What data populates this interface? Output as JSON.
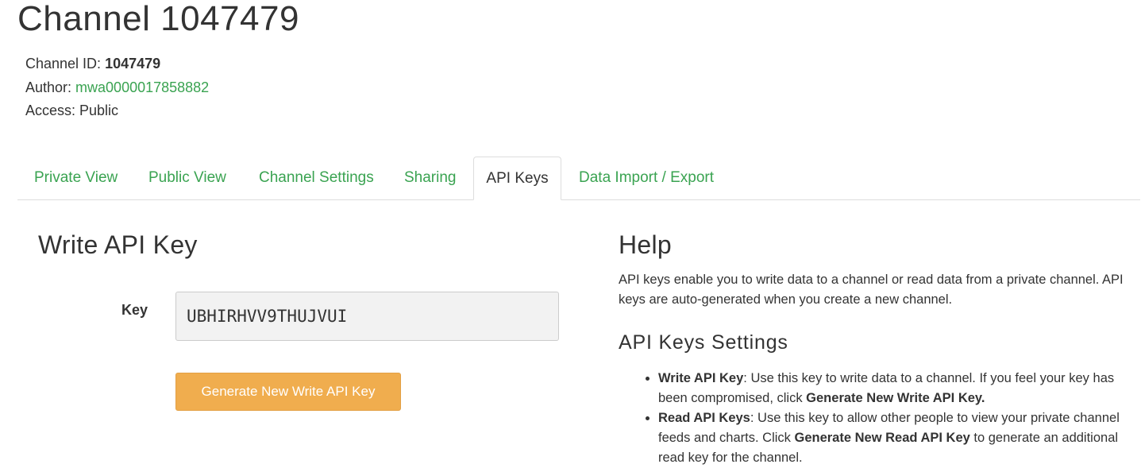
{
  "header": {
    "title": "Channel 1047479",
    "channel_id_label": "Channel ID: ",
    "channel_id_value": "1047479",
    "author_label": "Author: ",
    "author_value": "mwa0000017858882",
    "access_label": "Access: ",
    "access_value": "Public"
  },
  "tabs": [
    {
      "label": "Private View",
      "active": false
    },
    {
      "label": "Public View",
      "active": false
    },
    {
      "label": "Channel Settings",
      "active": false
    },
    {
      "label": "Sharing",
      "active": false
    },
    {
      "label": "API Keys",
      "active": true
    },
    {
      "label": "Data Import / Export",
      "active": false
    }
  ],
  "write_key": {
    "title": "Write API Key",
    "key_label": "Key",
    "key_value": "UBHIRHVV9THUJVUI",
    "generate_button_label": "Generate New Write API Key"
  },
  "help": {
    "title": "Help",
    "intro": "API keys enable you to write data to a channel or read data from a private channel. API keys are auto-generated when you create a new channel.",
    "settings_title": "API Keys Settings",
    "items": [
      {
        "term": "Write API Key",
        "text_before": ": Use this key to write data to a channel. If you feel your key has been compromised, click ",
        "emphasis": "Generate New Write API Key.",
        "text_after": ""
      },
      {
        "term": "Read API Keys",
        "text_before": ": Use this key to allow other people to view your private channel feeds and charts. Click ",
        "emphasis": "Generate New Read API Key",
        "text_after": " to generate an additional read key for the channel."
      }
    ]
  },
  "colors": {
    "link_green": "#3aa351",
    "button_orange": "#f0ad4e",
    "text": "#333333",
    "border": "#dddddd"
  }
}
